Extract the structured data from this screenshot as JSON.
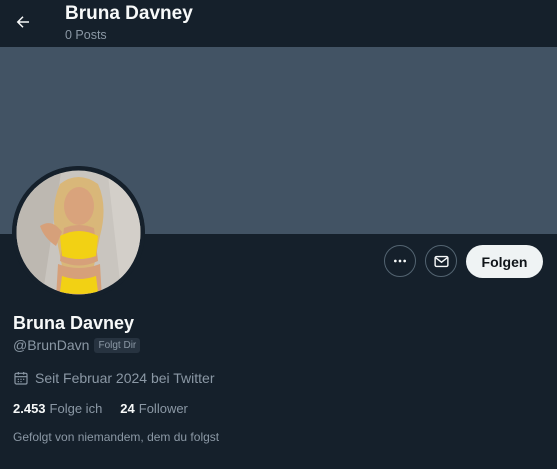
{
  "header": {
    "name": "Bruna Davney",
    "posts": "0 Posts",
    "back_icon": "arrow-left-icon"
  },
  "profile": {
    "display_name": "Bruna Davney",
    "handle": "@BrunDavn",
    "follows_you": "Folgt Dir",
    "joined": "Seit Februar 2024 bei Twitter",
    "following_count": "2.453",
    "following_label": "Folge ich",
    "followers_count": "24",
    "followers_label": "Follower",
    "followed_by": "Gefolgt von niemandem, dem du folgst"
  },
  "actions": {
    "more_icon": "more-icon",
    "message_icon": "mail-icon",
    "follow_label": "Folgen"
  },
  "colors": {
    "background": "#15202b",
    "banner": "#425364",
    "secondary_text": "#8b98a5",
    "follow_button": "#eff3f4"
  }
}
